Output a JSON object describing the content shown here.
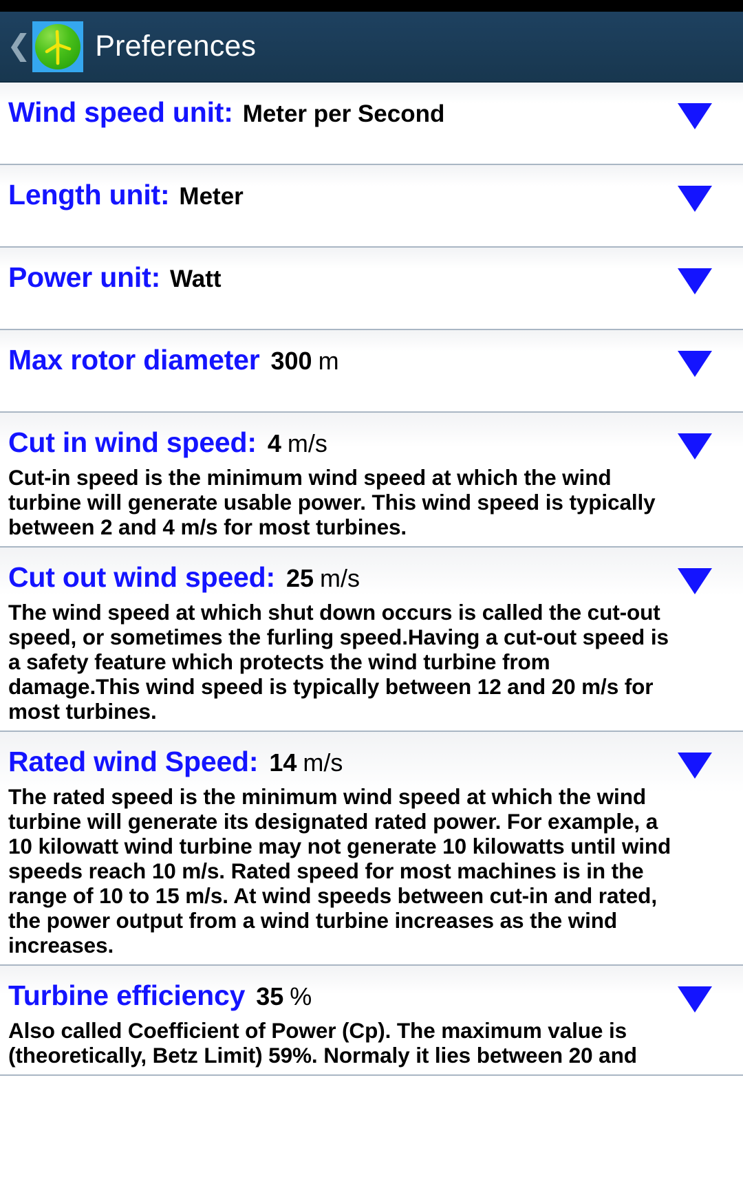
{
  "header": {
    "back_icon": "back-chevron-icon",
    "app_icon": "wind-turbine-icon",
    "title": "Preferences"
  },
  "colors": {
    "action_bar": "#1b3c57",
    "label_blue": "#1414ff",
    "icon_bg": "#35a7ef",
    "icon_circle": "#49c01a",
    "icon_turbine": "#f2e50c",
    "divider": "#a9b6c4"
  },
  "preferences": [
    {
      "label": "Wind speed unit:",
      "value": "Meter per Second",
      "unit": "",
      "description": "",
      "dropdown": "chevron-down-icon"
    },
    {
      "label": "Length unit:",
      "value": "Meter",
      "unit": "",
      "description": "",
      "dropdown": "chevron-down-icon"
    },
    {
      "label": "Power unit:",
      "value": "Watt",
      "unit": "",
      "description": "",
      "dropdown": "chevron-down-icon"
    },
    {
      "label": "Max rotor diameter",
      "value": "300",
      "unit": "m",
      "description": "",
      "dropdown": "chevron-down-icon"
    },
    {
      "label": "Cut in wind speed:",
      "value": "4",
      "unit": "m/s",
      "description": "Cut-in speed is the minimum wind speed at which the wind turbine will generate usable power. This wind speed is typically between 2 and 4 m/s for most turbines.",
      "dropdown": "chevron-down-icon"
    },
    {
      "label": "Cut out wind speed:",
      "value": "25",
      "unit": "m/s",
      "description": "The wind speed at which shut down occurs is called the cut-out speed, or sometimes the furling speed.Having a cut-out speed is a safety feature which protects the wind turbine from damage.This wind speed is typically between 12 and 20 m/s for most turbines.",
      "dropdown": "chevron-down-icon"
    },
    {
      "label": "Rated wind Speed:",
      "value": "14",
      "unit": "m/s",
      "description": "The rated speed is the minimum wind speed at which the wind turbine will generate its designated rated power. For example, a 10 kilowatt wind turbine may not generate 10 kilowatts until wind speeds reach 10 m/s. Rated speed for most machines is in the range of 10 to 15 m/s. At wind speeds between cut-in and rated, the power output from a wind turbine increases as the wind increases.",
      "dropdown": "chevron-down-icon"
    },
    {
      "label": "Turbine efficiency",
      "value": "35",
      "unit": "%",
      "description": "Also called Coefficient of Power (Cp). The maximum value is (theoretically, Betz Limit) 59%. Normaly it lies between 20 and",
      "dropdown": "chevron-down-icon"
    }
  ]
}
